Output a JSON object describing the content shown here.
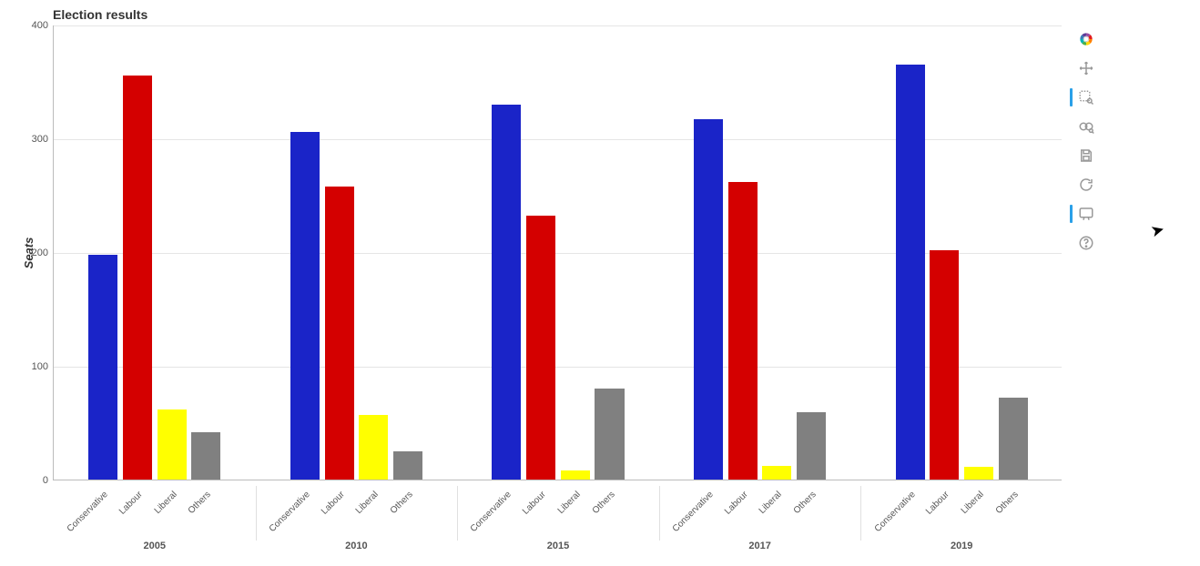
{
  "title": "Election results",
  "toolbar": {
    "logo_name": "bokeh-logo",
    "pan": "Pan",
    "box_zoom": "Box Zoom",
    "wheel_zoom": "Wheel Zoom",
    "save": "Save",
    "reset": "Reset",
    "hover": "Hover",
    "help": "Help"
  },
  "chart_data": {
    "type": "bar",
    "title": "Election results",
    "xlabel": "",
    "ylabel": "Seats",
    "ylim": [
      0,
      400
    ],
    "y_ticks": [
      0,
      100,
      200,
      300,
      400
    ],
    "sub_categories": [
      "Conservative",
      "Labour",
      "Liberal",
      "Others"
    ],
    "colors": {
      "Conservative": "#1a24c8",
      "Labour": "#d40000",
      "Liberal": "#ffff00",
      "Others": "#808080"
    },
    "groups": [
      {
        "name": "2005",
        "values": {
          "Conservative": 198,
          "Labour": 355,
          "Liberal": 62,
          "Others": 42
        }
      },
      {
        "name": "2010",
        "values": {
          "Conservative": 306,
          "Labour": 258,
          "Liberal": 57,
          "Others": 25
        }
      },
      {
        "name": "2015",
        "values": {
          "Conservative": 330,
          "Labour": 232,
          "Liberal": 8,
          "Others": 80
        }
      },
      {
        "name": "2017",
        "values": {
          "Conservative": 317,
          "Labour": 262,
          "Liberal": 12,
          "Others": 59
        }
      },
      {
        "name": "2019",
        "values": {
          "Conservative": 365,
          "Labour": 202,
          "Liberal": 11,
          "Others": 72
        }
      }
    ]
  }
}
